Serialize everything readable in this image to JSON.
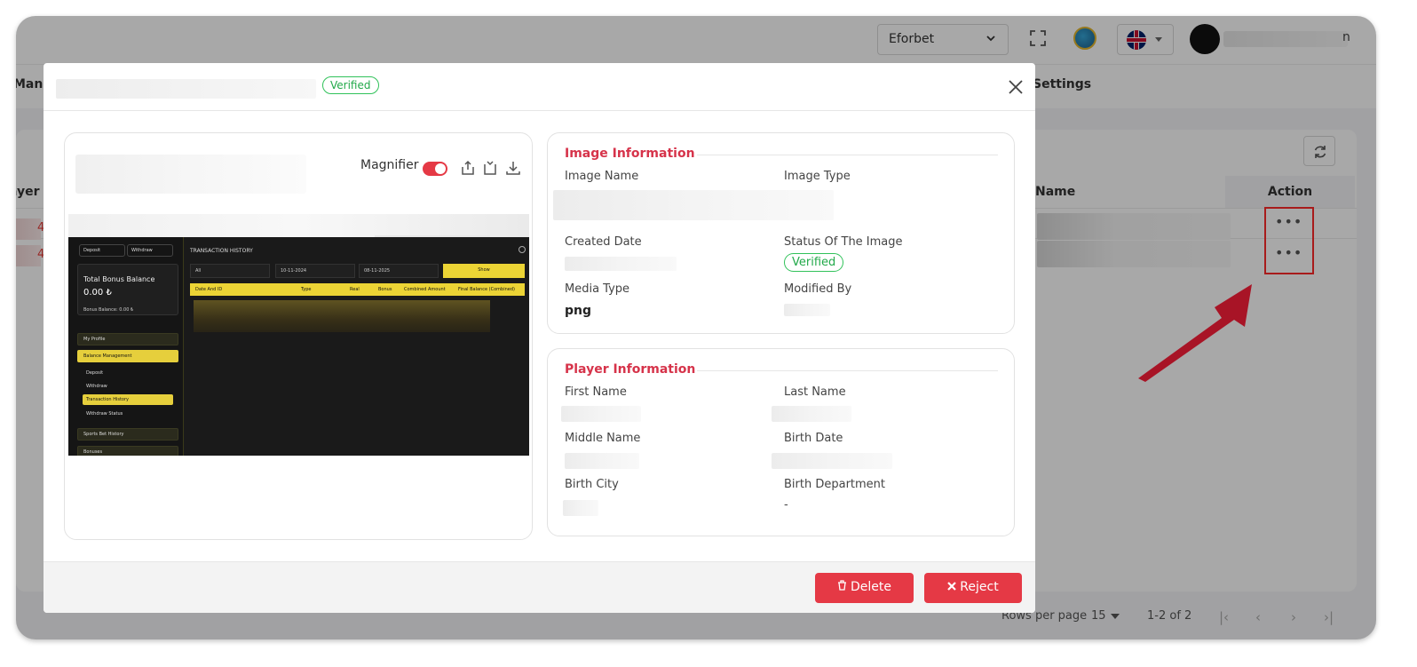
{
  "background": {
    "brand_select": "Eforbet",
    "user_suffix": "n",
    "nav_left": "Mana",
    "nav_right": "Settings",
    "table_headers": {
      "player": "ayer",
      "name": "Name",
      "action": "Action"
    },
    "row_action": "•••",
    "footer": {
      "rows_per_page_label": "Rows per page",
      "rows_per_page": "15",
      "range": "1-2 of 2"
    },
    "pagination": [
      "|‹",
      "‹",
      "›",
      "›|"
    ],
    "highlight_color": "#ff2a2a"
  },
  "modal": {
    "status_badge": "Verified",
    "close_icon": "close-icon",
    "preview": {
      "magnifier_label": "Magnifier",
      "magnifier_on": true,
      "tools": [
        "rotate-left-icon",
        "rotate-right-icon",
        "download-icon"
      ],
      "screenshot": {
        "deposit": "Deposit",
        "withdraw": "Withdraw",
        "balance_title": "Total Bonus Balance",
        "balance_value": "0.00 ₺",
        "bonus_balance": "Bonus Balance: 0.00 ₺",
        "menu": [
          "My Profile",
          "Balance Management"
        ],
        "submenu": [
          "Deposit",
          "Withdraw",
          "Transaction History",
          "Withdraw Status"
        ],
        "menu_bottom": [
          "Sports Bet History",
          "Bonuses"
        ],
        "title": "TRANSACTION HISTORY",
        "filter_all": "All",
        "date_from": "10-11-2024",
        "date_to": "08-11-2025",
        "show_button": "Show",
        "columns": [
          "Date And ID",
          "Type",
          "Real",
          "Bonus",
          "Combined Amount",
          "Final Balance (Combined)"
        ]
      }
    },
    "image_info": {
      "title": "Image Information",
      "image_name_label": "Image Name",
      "image_type_label": "Image Type",
      "created_date_label": "Created Date",
      "status_label": "Status Of The Image",
      "status_value": "Verified",
      "media_type_label": "Media Type",
      "media_type_value": "png",
      "modified_by_label": "Modified By"
    },
    "player_info": {
      "title": "Player Information",
      "first_name_label": "First Name",
      "last_name_label": "Last Name",
      "middle_name_label": "Middle Name",
      "birth_date_label": "Birth Date",
      "birth_city_label": "Birth City",
      "birth_department_label": "Birth Department",
      "birth_department_value": "-"
    },
    "buttons": {
      "delete": "Delete",
      "reject": "Reject"
    },
    "accent_color": "#e53945",
    "verified_color": "#31c25a"
  }
}
